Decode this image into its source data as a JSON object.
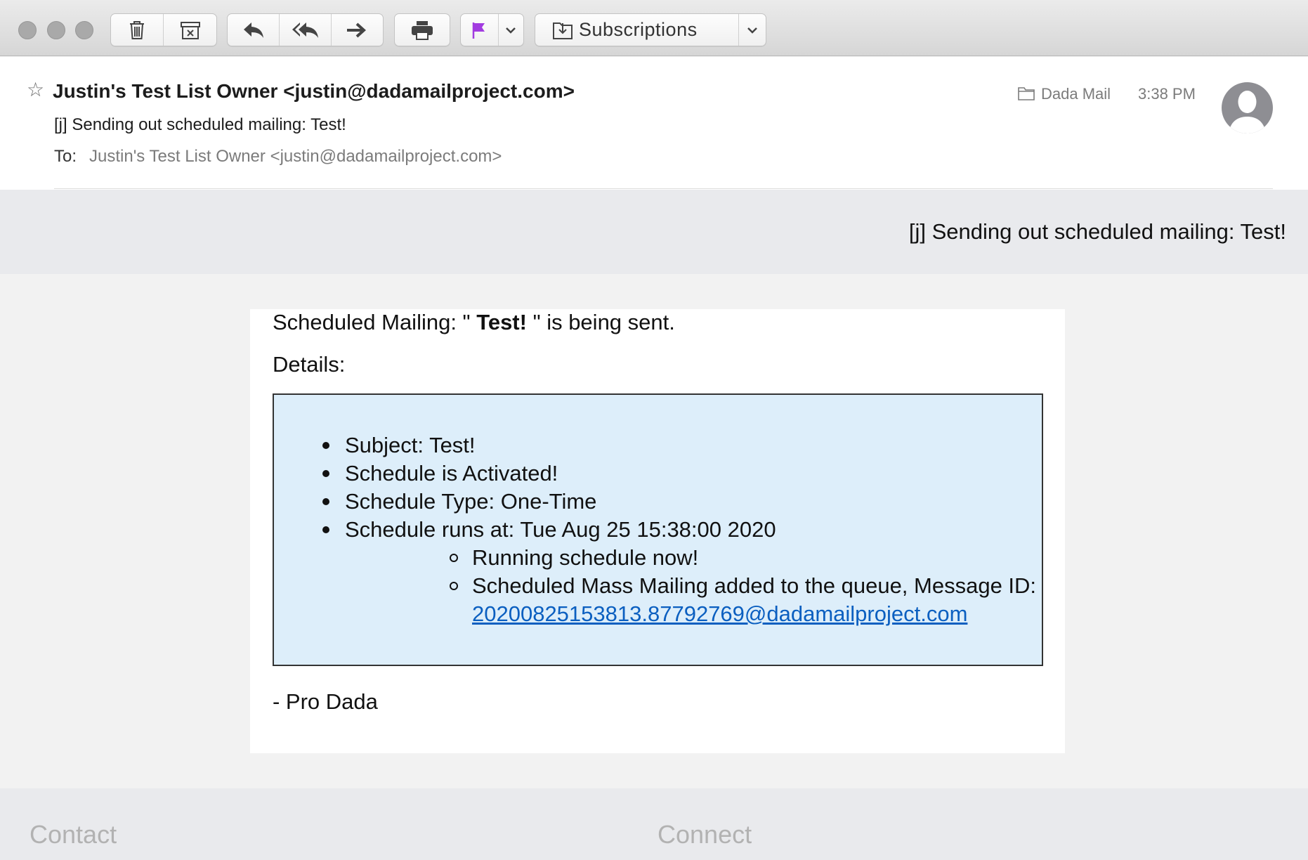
{
  "toolbar": {
    "mailbox_label": "Subscriptions",
    "flag_color": "#a23ce0"
  },
  "header": {
    "from": "Justin's Test List Owner <justin@dadamailproject.com>",
    "subject": "[j] Sending out scheduled mailing: Test!",
    "to_label": "To:",
    "to_value": "Justin's Test List Owner <justin@dadamailproject.com>",
    "folder": "Dada Mail",
    "time": "3:38 PM"
  },
  "email": {
    "banner_title": "[j] Sending out scheduled mailing: Test!",
    "intro_prefix": "Scheduled Mailing: \"",
    "intro_name": "Test!",
    "intro_suffix": "\" is being sent.",
    "details_label": "Details:",
    "details": [
      "Subject: Test!",
      "Schedule is Activated!",
      "Schedule Type: One-Time",
      "Schedule runs at: Tue Aug 25 15:38:00 2020"
    ],
    "sub_details": [
      "Running schedule now!",
      "Scheduled Mass Mailing added to the queue, Message ID:"
    ],
    "message_id": "20200825153813.87792769@dadamailproject.com",
    "signoff": "- Pro Dada",
    "details_bg": "#ddeefa",
    "link_color": "#0b5fc0"
  },
  "footer": {
    "contact": "Contact",
    "connect": "Connect"
  }
}
